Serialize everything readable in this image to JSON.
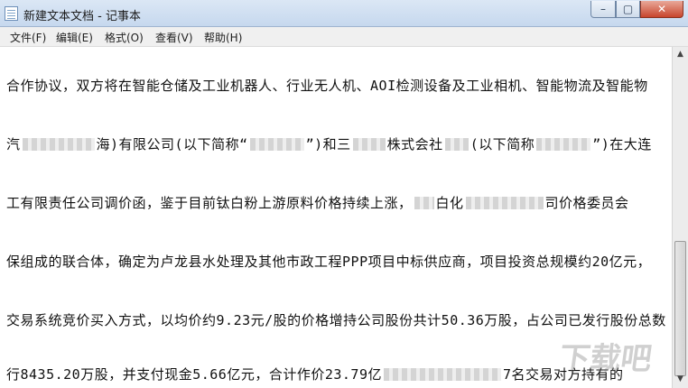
{
  "window": {
    "title": "新建文本文档 - 记事本"
  },
  "controls": {
    "minimize": "–",
    "maximize": "▢",
    "close": "✕"
  },
  "menu": [
    {
      "label": "文件(F)"
    },
    {
      "label": "编辑(E)"
    },
    {
      "label": "格式(O)"
    },
    {
      "label": "查看(V)"
    },
    {
      "label": "帮助(H)"
    }
  ],
  "document": {
    "lines": [
      {
        "a": "合作协议，双方将在智能仓储及工业机器人、行业无人机、AOI检测设备及工业相机、智能物流及智能物"
      },
      {
        "a": "汽",
        "b": "海)有限公司(以下简称“",
        "c": "”)和三",
        "d": "株式会社",
        "e": "(以下简称",
        "f": "”)在大连"
      },
      {
        "a": "工有限责任公司调价函，鉴于目前钛白粉上游原料价格持续上涨，",
        "b": "白化",
        "c": "司价格委员会"
      },
      {
        "a": "保组成的联合体，确定为卢龙县水处理及其他市政工程PPP项目中标供应商，项目投资总规模约20亿元，"
      },
      {
        "a": "交易系统竞价买入方式，以均价约9.23元/股的价格增持公司股份共计50.36万股，占公司已发行股份总数"
      },
      {
        "a": "行8435.20万股，并支付现金5.66亿元，合计作价23.79亿",
        "b": "7名交易对方持有的"
      }
    ]
  },
  "scrollbar": {
    "up": "▲",
    "down": "▼"
  },
  "watermark": "下载吧"
}
